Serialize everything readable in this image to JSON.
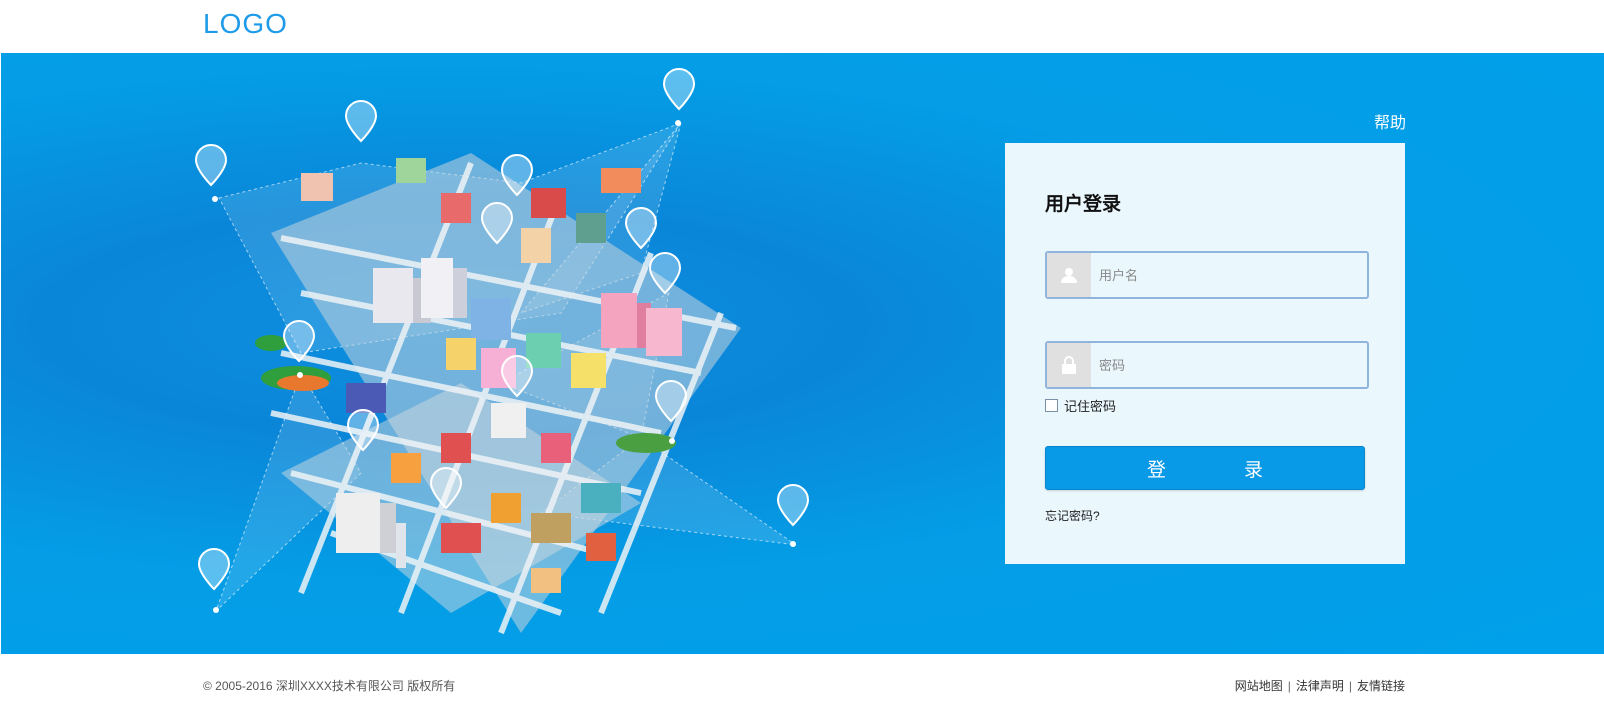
{
  "header": {
    "logo": "LOGO"
  },
  "banner": {
    "help_label": "帮助",
    "background_color": "#00a0ea",
    "illustration": "isometric-city-map-with-location-pins",
    "pin_icons": [
      "flag-icon",
      "wrench-icon",
      "smile-icon",
      "book-icon",
      "monitor-icon",
      "car-icon",
      "home-icon",
      "runner-icon",
      "cart-icon",
      "camera-icon",
      "building-icon",
      "fork-knife-icon",
      "airplane-icon",
      "bus-icon"
    ]
  },
  "login": {
    "title": "用户登录",
    "username_placeholder": "用户名",
    "password_placeholder": "密码",
    "remember_label": "记住密码",
    "submit_label": "登录",
    "forgot_label": "忘记密码?",
    "accent_color": "#0899e7"
  },
  "footer": {
    "copyright": "© 2005-2016 深圳XXXX技术有限公司 版权所有",
    "links": [
      "网站地图",
      "法律声明",
      "友情链接"
    ],
    "separator": "|"
  }
}
